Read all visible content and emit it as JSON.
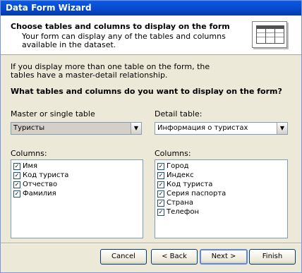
{
  "window": {
    "title": "Data Form Wizard"
  },
  "header": {
    "title": "Choose tables and columns to display on the form",
    "subtitle": "Your form can display any of the tables and columns available in the dataset."
  },
  "intro": "If you display more than one table on the form, the tables have a master-detail relationship.",
  "question": "What tables and columns do you want to display on the form?",
  "master": {
    "label": "Master or single table",
    "selected": "Туристы",
    "columns_label": "Columns:",
    "columns": [
      "Имя",
      "Код туриста",
      "Отчество",
      "Фамилия"
    ]
  },
  "detail": {
    "label": "Detail table:",
    "selected": "Информация о туристах",
    "columns_label": "Columns:",
    "columns": [
      "Город",
      "Индекс",
      "Код туриста",
      "Серия паспорта",
      "Страна",
      "Телефон"
    ]
  },
  "buttons": {
    "cancel": "Cancel",
    "back": "< Back",
    "next": "Next >",
    "finish": "Finish"
  },
  "checkbox_mark": "✓"
}
